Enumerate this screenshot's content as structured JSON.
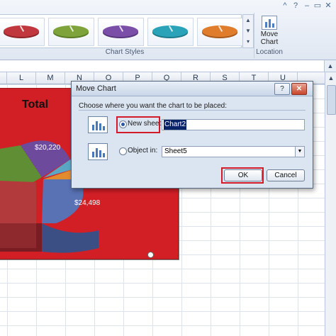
{
  "ribbon": {
    "chart_styles_label": "Chart Styles",
    "location_label": "Location",
    "move_chart_label_line1": "Move",
    "move_chart_label_line2": "Chart",
    "style_colors": [
      "#c0383e",
      "#7ea33a",
      "#7b4fa8",
      "#2aa3b8",
      "#e07d2d"
    ]
  },
  "columns": [
    "L",
    "M",
    "N",
    "O",
    "P",
    "Q",
    "R",
    "S",
    "T",
    "U"
  ],
  "chart": {
    "title": "Total",
    "labels": [
      "$20,220",
      "$24,498"
    ],
    "background": "#d21f26"
  },
  "dialog": {
    "title": "Move Chart",
    "prompt": "Choose where you want the chart to be placed:",
    "new_sheet_label": "New sheet:",
    "new_sheet_value": "Chart2",
    "object_in_label": "Object in:",
    "object_in_value": "Sheet5",
    "ok_label": "OK",
    "cancel_label": "Cancel",
    "help_label": "?",
    "close_label": "✕"
  }
}
